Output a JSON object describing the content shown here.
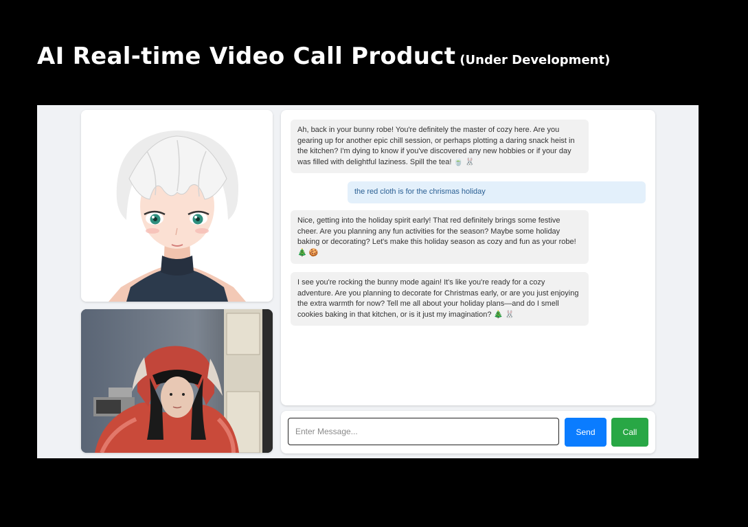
{
  "headline": {
    "title": "AI Real-time Video Call Product",
    "subtitle": "(Under Development)"
  },
  "chat": {
    "messages": [
      {
        "role": "ai",
        "text": "Ah, back in your bunny robe! You're definitely the master of cozy here. Are you gearing up for another epic chill session, or perhaps plotting a daring snack heist in the kitchen? I'm dying to know if you've discovered any new hobbies or if your day was filled with delightful laziness. Spill the tea! 🍵 🐰"
      },
      {
        "role": "user",
        "text": "the red cloth is for the chrismas holiday"
      },
      {
        "role": "ai",
        "text": "Nice, getting into the holiday spirit early! That red definitely brings some festive cheer. Are you planning any fun activities for the season? Maybe some holiday baking or decorating? Let's make this holiday season as cozy and fun as your robe! 🎄 🍪"
      },
      {
        "role": "ai",
        "text": "I see you're rocking the bunny mode again! It's like you're ready for a cozy adventure. Are you planning to decorate for Christmas early, or are you just enjoying the extra warmth for now? Tell me all about your holiday plans—and do I smell cookies baking in that kitchen, or is it just my imagination? 🎄 🐰"
      }
    ]
  },
  "input": {
    "placeholder": "Enter Message...",
    "value": ""
  },
  "buttons": {
    "send": "Send",
    "call": "Call"
  },
  "colors": {
    "send": "#0a7cff",
    "call": "#28a745",
    "user_bubble": "#e3f0fb",
    "ai_bubble": "#f1f1f1"
  }
}
